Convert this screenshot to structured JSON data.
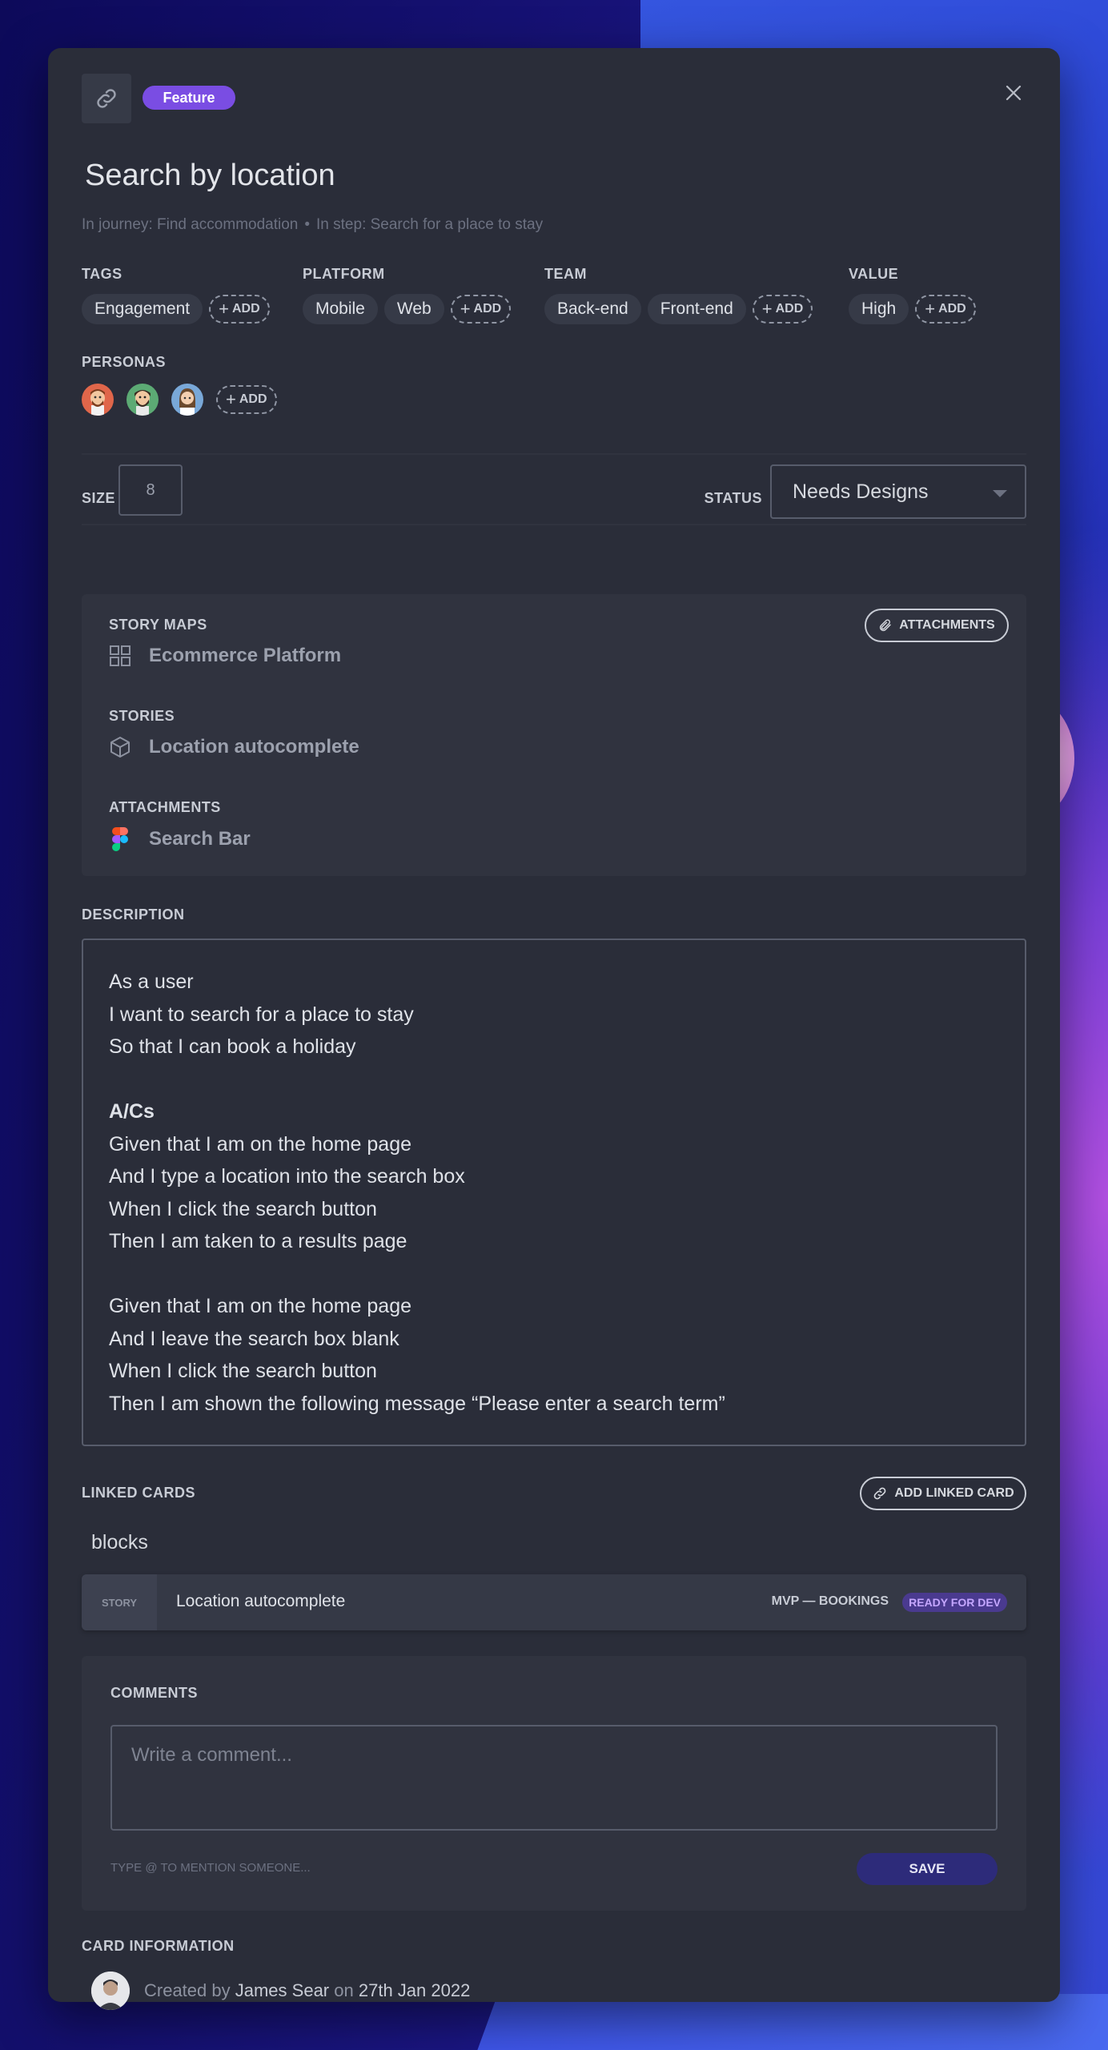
{
  "card": {
    "type_badge": "Feature",
    "title": "Search by location",
    "journey": "In journey: Find accommodation",
    "step": "In step: Search for a place to stay",
    "separator": "•",
    "add_label": "ADD"
  },
  "groups": {
    "tags": {
      "label": "TAGS",
      "items": [
        "Engagement"
      ]
    },
    "platform": {
      "label": "PLATFORM",
      "items": [
        "Mobile",
        "Web"
      ]
    },
    "team": {
      "label": "TEAM",
      "items": [
        "Back-end",
        "Front-end"
      ]
    },
    "value": {
      "label": "VALUE",
      "items": [
        "High"
      ]
    }
  },
  "personas": {
    "label": "PERSONAS"
  },
  "size": {
    "label": "SIZE",
    "value": "8"
  },
  "status": {
    "label": "STATUS",
    "value": "Needs Designs"
  },
  "links": {
    "attachments_button": "ATTACHMENTS",
    "story_maps": {
      "label": "STORY MAPS",
      "item": "Ecommerce Platform"
    },
    "stories": {
      "label": "STORIES",
      "item": "Location autocomplete"
    },
    "attachments": {
      "label": "ATTACHMENTS",
      "item": "Search Bar"
    }
  },
  "description": {
    "label": "DESCRIPTION",
    "lines": [
      "As a user",
      "I want to search for a place to stay",
      "So that I can book a holiday",
      "",
      "A/Cs",
      "Given that I am on the home page",
      "And I type a location into the search box",
      "When I click the search button",
      "Then I am taken to a results page",
      "",
      "Given that I am on the home page",
      "And I leave the search box blank",
      "When I click the search button",
      "Then I am shown the following message “Please enter a search term”"
    ]
  },
  "linked_cards": {
    "label": "LINKED CARDS",
    "add_button": "ADD LINKED CARD",
    "relation": "blocks",
    "card": {
      "type": "STORY",
      "name": "Location autocomplete",
      "map": "MVP — BOOKINGS",
      "status": "READY FOR DEV"
    }
  },
  "comments": {
    "label": "COMMENTS",
    "placeholder": "Write a comment...",
    "hint": "TYPE @ TO MENTION SOMEONE...",
    "save": "SAVE"
  },
  "card_information": {
    "label": "CARD INFORMATION",
    "created_by_prefix": "Created by",
    "author": "James Sear",
    "on": "on",
    "date": "27th Jan 2022"
  },
  "colors": {
    "modal_bg": "#2a2d39",
    "feature_badge": "#7a4de3",
    "save_button": "#2d2b7a",
    "ready_badge": "#4a3a8f"
  }
}
